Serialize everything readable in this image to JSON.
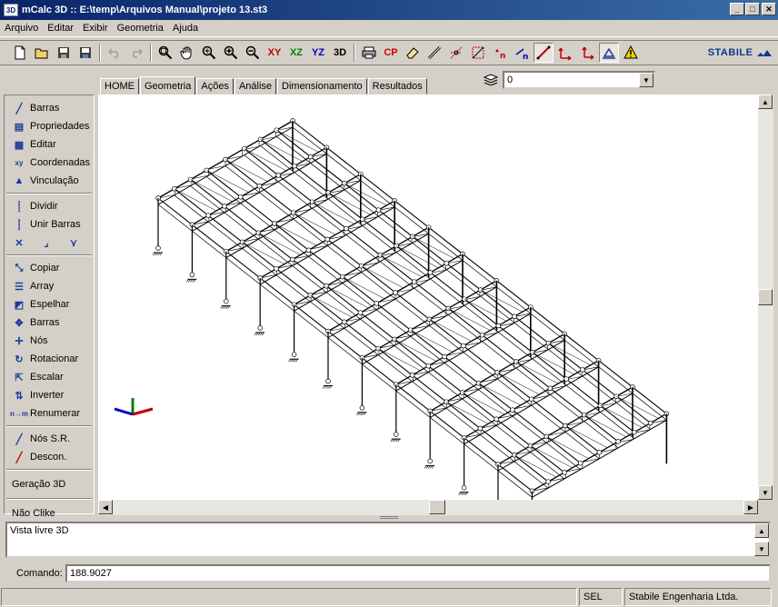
{
  "window": {
    "title": "mCalc 3D :: E:\\temp\\Arquivos Manual\\projeto 13.st3",
    "app_icon": "3D",
    "buttons": [
      "_",
      "□",
      "✕"
    ]
  },
  "menu": [
    "Arquivo",
    "Editar",
    "Exibir",
    "Geometria",
    "Ajuda"
  ],
  "toolbar": {
    "view_xy": "XY",
    "view_xz": "XZ",
    "view_yz": "YZ",
    "view_3d": "3D",
    "cp": "CP",
    "brand": "STABILE"
  },
  "tabs": [
    "HOME",
    "Geometria",
    "Ações",
    "Análise",
    "Dimensionamento",
    "Resultados"
  ],
  "active_tab": "Geometria",
  "layer": {
    "value": "0"
  },
  "sidebar": {
    "group1": [
      "Barras",
      "Propriedades",
      "Editar",
      "Coordenadas",
      "Vinculação"
    ],
    "group2": [
      "Dividir",
      "Unir Barras"
    ],
    "group3": [
      "Copiar",
      "Array",
      "Espelhar",
      "Barras",
      "Nós",
      "Rotacionar",
      "Escalar",
      "Inverter",
      "Renumerar"
    ],
    "group4": [
      "Nós S.R.",
      "Descon."
    ],
    "group5": [
      "Geração 3D"
    ],
    "group6": [
      "Não Clike"
    ]
  },
  "log": {
    "text": "Vista livre 3D"
  },
  "command": {
    "label": "Comando:",
    "value": "188.9027"
  },
  "status": {
    "mode": "SEL",
    "company": "Stabile Engenharia Ltda."
  },
  "colors": {
    "title_start": "#0a246a",
    "title_end": "#3a6ea5",
    "brand": "#0a3a8a"
  }
}
